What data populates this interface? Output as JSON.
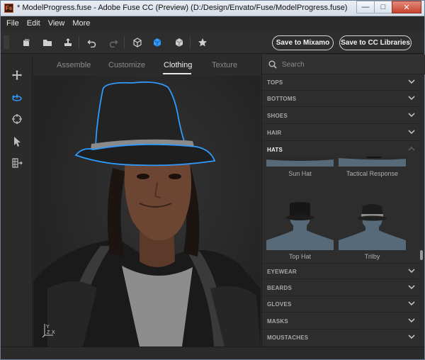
{
  "window": {
    "title": "* ModelProgress.fuse - Adobe Fuse CC (Preview) (D:/Design/Envato/Fuse/ModelProgress.fuse)",
    "app_icon_text": "Fs"
  },
  "menu": [
    "File",
    "Edit",
    "View",
    "More"
  ],
  "toolbar": {
    "save_mixamo": "Save to Mixamo",
    "save_cc": "Save to CC Libraries",
    "accent": "#2f9bff"
  },
  "tabs": [
    {
      "label": "Assemble"
    },
    {
      "label": "Customize"
    },
    {
      "label": "Clothing"
    },
    {
      "label": "Texture"
    }
  ],
  "search": {
    "placeholder": "Search"
  },
  "categories_top": [
    "TOPS",
    "BOTTOMS",
    "SHOES",
    "HAIR",
    "HATS"
  ],
  "hats": [
    "Sun Hat",
    "Tactical Response",
    "Top Hat",
    "Trilby"
  ],
  "categories_bottom": [
    "EYEWEAR",
    "BEARDS",
    "GLOVES",
    "MASKS",
    "MOUSTACHES"
  ],
  "viewport": {
    "axis_label": "Y\nZ X"
  }
}
